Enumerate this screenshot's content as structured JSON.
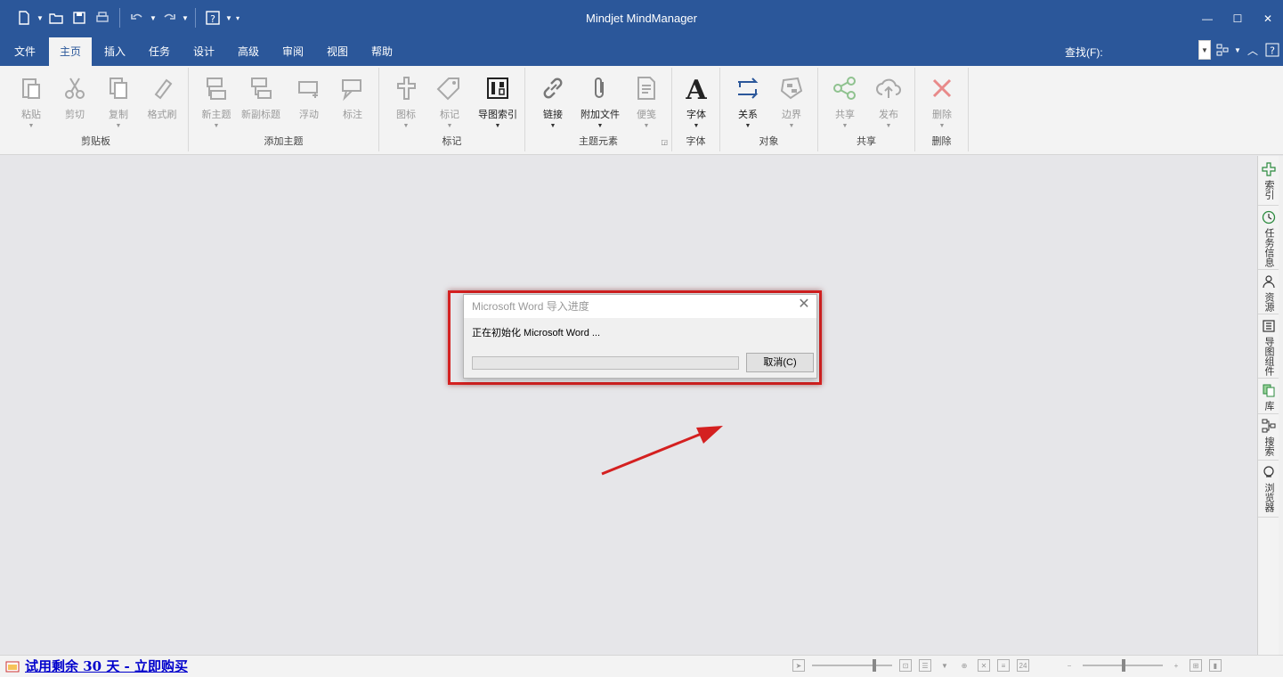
{
  "app": {
    "title": "Mindjet MindManager"
  },
  "window_controls": {
    "minimize": "—",
    "maximize": "☐",
    "close": "✕"
  },
  "menu": {
    "tabs": [
      {
        "label": "文件"
      },
      {
        "label": "主页",
        "active": true
      },
      {
        "label": "插入"
      },
      {
        "label": "任务"
      },
      {
        "label": "设计"
      },
      {
        "label": "高级"
      },
      {
        "label": "审阅"
      },
      {
        "label": "视图"
      },
      {
        "label": "帮助"
      }
    ],
    "find_label": "查找(F):"
  },
  "ribbon": {
    "groups": [
      {
        "label": "剪贴板",
        "buttons": [
          {
            "label": "粘贴"
          },
          {
            "label": "剪切"
          },
          {
            "label": "复制"
          },
          {
            "label": "格式刷"
          }
        ]
      },
      {
        "label": "添加主题",
        "buttons": [
          {
            "label": "新主题"
          },
          {
            "label": "新副标题"
          },
          {
            "label": "浮动"
          },
          {
            "label": "标注"
          }
        ]
      },
      {
        "label": "标记",
        "buttons": [
          {
            "label": "图标"
          },
          {
            "label": "标记"
          },
          {
            "label": "导图索引"
          }
        ]
      },
      {
        "label": "主题元素",
        "buttons": [
          {
            "label": "链接"
          },
          {
            "label": "附加文件"
          },
          {
            "label": "便笺"
          }
        ]
      },
      {
        "label": "字体",
        "buttons": [
          {
            "label": "字体"
          }
        ]
      },
      {
        "label": "对象",
        "buttons": [
          {
            "label": "关系"
          },
          {
            "label": "边界"
          }
        ]
      },
      {
        "label": "共享",
        "buttons": [
          {
            "label": "共享"
          },
          {
            "label": "发布"
          }
        ]
      },
      {
        "label": "删除",
        "buttons": [
          {
            "label": "删除"
          }
        ]
      }
    ]
  },
  "side_panel": {
    "items": [
      {
        "label": "索引",
        "icon": "index-icon"
      },
      {
        "label": "任务信息",
        "icon": "clock-icon"
      },
      {
        "label": "资源",
        "icon": "person-icon"
      },
      {
        "label": "导图组件",
        "icon": "map-parts-icon"
      },
      {
        "label": "库",
        "icon": "library-icon"
      },
      {
        "label": "搜索",
        "icon": "search-tree-icon"
      },
      {
        "label": "浏览器",
        "icon": "browser-icon"
      }
    ]
  },
  "dialog": {
    "title": "Microsoft Word 导入进度",
    "message": "正在初始化 Microsoft Word ...",
    "progress": 0,
    "cancel_label": "取消(C)"
  },
  "status": {
    "trial_text": "试用剩余 30 天 - 立即购买",
    "zoom_value": "24"
  },
  "colors": {
    "accent": "#2b579a",
    "highlight": "#d42020",
    "trial_link": "#0000cc"
  }
}
